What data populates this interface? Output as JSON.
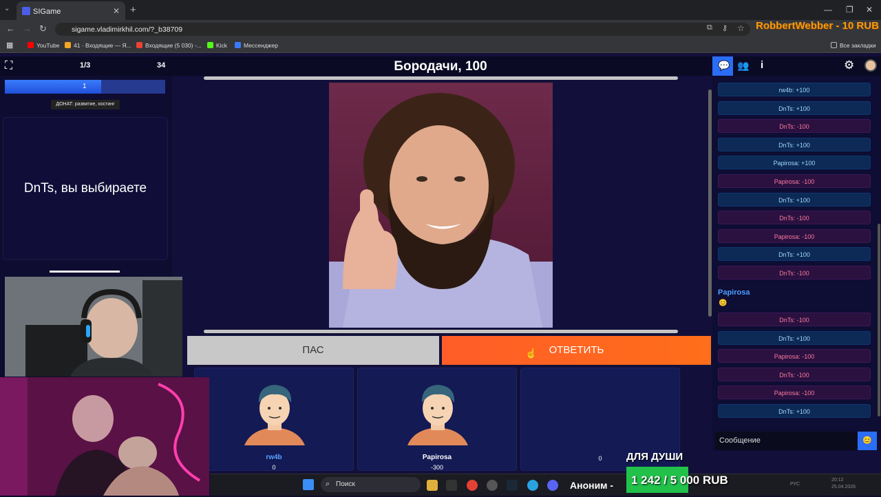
{
  "browser": {
    "tab_title": "SIGame",
    "url": "sigame.vladimirkhil.com/?_b38709",
    "bookmarks": [
      "YouTube",
      "41 · Входящие — Я...",
      "Входящие (5 030) -...",
      "Kick",
      "Мессенджер"
    ],
    "all_bookmarks_label": "Все закладки"
  },
  "overlay": {
    "donor_text": "RobbertWebber - 10 RUB",
    "donation_label": "ДЛЯ ДУШИ",
    "donation_amount": "1 242 / 5 000 RUB",
    "anon_text": "Аноним -"
  },
  "game": {
    "round_counter": "1/3",
    "score_counter": "34",
    "progress_value": "1",
    "progress_fraction": 0.6,
    "donate_tooltip": "ДОНАТ: развитие, хостинг",
    "choose_text": "DnTs, вы выбираете",
    "question_title": "Бородачи, 100",
    "pass_label": "ПАС",
    "answer_label": "ОТВЕТИТЬ",
    "players": [
      {
        "name": "rw4b",
        "score": "0",
        "color": "#5aa2ff"
      },
      {
        "name": "Papirosa",
        "score": "-300",
        "color": "#ffffff"
      },
      {
        "name": "",
        "score": "0",
        "color": "#ffffff"
      }
    ]
  },
  "chat": {
    "messages_top": [
      {
        "text": "rw4b: +100",
        "type": "plus"
      },
      {
        "text": "DnTs: +100",
        "type": "plus"
      },
      {
        "text": "DnTs: -100",
        "type": "minus"
      },
      {
        "text": "DnTs: +100",
        "type": "plus"
      },
      {
        "text": "Papirosa: +100",
        "type": "plus"
      },
      {
        "text": "Papirosa: -100",
        "type": "minus"
      },
      {
        "text": "DnTs: +100",
        "type": "plus"
      },
      {
        "text": "DnTs: -100",
        "type": "minus"
      },
      {
        "text": "Papirosa: -100",
        "type": "minus"
      },
      {
        "text": "DnTs: +100",
        "type": "plus"
      },
      {
        "text": "DnTs: -100",
        "type": "minus"
      }
    ],
    "user_message_author": "Papirosa",
    "user_message_text": "😊",
    "messages_bottom": [
      {
        "text": "DnTs: -100",
        "type": "minus"
      },
      {
        "text": "DnTs: +100",
        "type": "plus"
      },
      {
        "text": "Papirosa: -100",
        "type": "minus"
      },
      {
        "text": "DnTs: -100",
        "type": "minus"
      },
      {
        "text": "Papirosa: -100",
        "type": "minus"
      },
      {
        "text": "DnTs: +100",
        "type": "plus"
      }
    ],
    "input_placeholder": "Сообщение"
  },
  "taskbar": {
    "search_label": "Поиск",
    "lang": "РУС",
    "time": "20:12",
    "date": "25.04.2026"
  }
}
